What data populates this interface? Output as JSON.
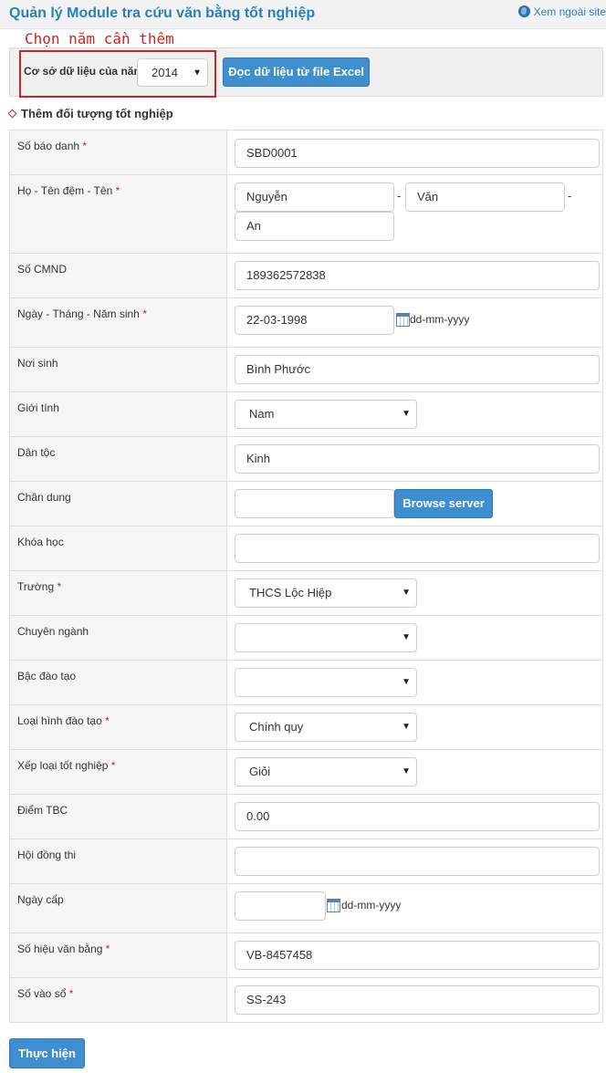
{
  "header": {
    "title": "Quản lý Module tra cứu văn bằng tốt nghiệp",
    "view_outside": "Xem ngoài site"
  },
  "annotation": "Chọn năm cần thêm",
  "database": {
    "label": "Cơ sở dữ liệu của năm:",
    "year": "2014",
    "excel_button": "Đọc dữ liệu từ file Excel"
  },
  "section_title": "Thêm đối tượng tốt nghiệp",
  "form": {
    "candidate_no": {
      "label": "Số báo danh",
      "value": "SBD0001"
    },
    "name": {
      "label": "Họ - Tên đệm - Tên",
      "last": "Nguyễn",
      "middle": "Văn",
      "first": "An",
      "sep": "-"
    },
    "id_card": {
      "label": "Số CMND",
      "value": "189362572838"
    },
    "birth_date": {
      "label": "Ngày - Tháng - Năm sinh",
      "value": "22-03-1998",
      "hint": "dd-mm-yyyy"
    },
    "birth_place": {
      "label": "Nơi sinh",
      "value": "Bình Phước"
    },
    "gender": {
      "label": "Giới tính",
      "value": "Nam"
    },
    "ethnicity": {
      "label": "Dân tộc",
      "value": "Kinh"
    },
    "portrait": {
      "label": "Chân dung",
      "value": "",
      "browse_button": "Browse server"
    },
    "course": {
      "label": "Khóa học",
      "value": ""
    },
    "school": {
      "label": "Trường",
      "value": "THCS Lộc Hiệp"
    },
    "major": {
      "label": "Chuyên ngành",
      "value": ""
    },
    "level": {
      "label": "Bậc đào tạo",
      "value": ""
    },
    "training_type": {
      "label": "Loại hình đào tạo",
      "value": "Chính quy"
    },
    "grade": {
      "label": "Xếp loại tốt nghiệp",
      "value": "Giỏi"
    },
    "gpa": {
      "label": "Điểm TBC",
      "value": "0.00"
    },
    "exam_council": {
      "label": "Hội đồng thi",
      "value": ""
    },
    "issue_date": {
      "label": "Ngày cấp",
      "value": "",
      "hint": "dd-mm-yyyy"
    },
    "diploma_no": {
      "label": "Số hiệu văn bằng",
      "value": "VB-8457458"
    },
    "registry_no": {
      "label": "Số vào sổ",
      "value": "SS-243"
    }
  },
  "required_mark": "*",
  "submit_button": "Thực hiện",
  "colors": {
    "accent": "#3e8ed0",
    "title": "#2a80b9",
    "required": "#d32222"
  }
}
